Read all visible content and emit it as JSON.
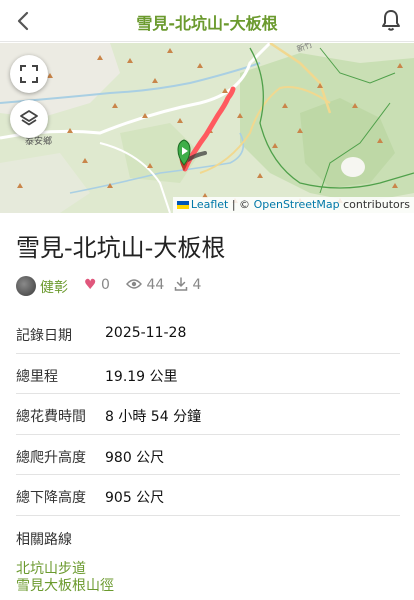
{
  "header": {
    "title": "雪見-北坑山-大板根"
  },
  "map": {
    "place_labels": [
      "泰安鄉",
      "新竹"
    ],
    "attribution": {
      "leaflet": "Leaflet",
      "separator": "| ©",
      "osm": "OpenStreetMap",
      "suffix": "contributors"
    }
  },
  "route": {
    "title": "雪見-北坑山-大板根",
    "author": "健彰",
    "likes": "0",
    "views": "44",
    "downloads": "4"
  },
  "details": [
    {
      "label": "記錄日期",
      "value": "2025-11-28"
    },
    {
      "label": "總里程",
      "value": "19.19 公里"
    },
    {
      "label": "總花費時間",
      "value": "8 小時 54 分鐘"
    },
    {
      "label": "總爬升高度",
      "value": "980 公尺"
    },
    {
      "label": "總下降高度",
      "value": "905 公尺"
    }
  ],
  "related": {
    "label": "相關路線",
    "links": [
      "北坑山步道",
      "雪見大板根山徑"
    ]
  }
}
